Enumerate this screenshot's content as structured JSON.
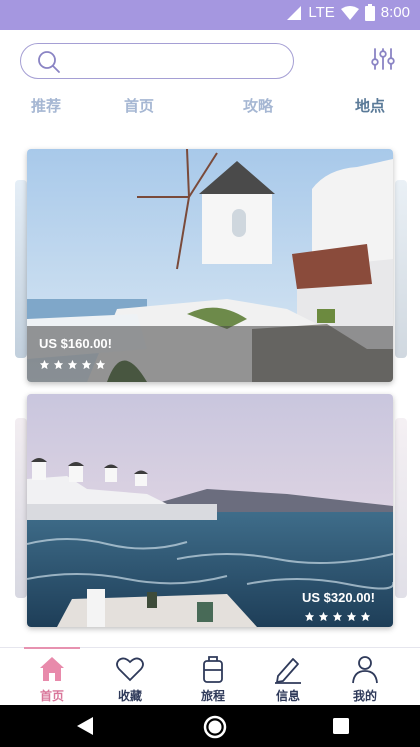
{
  "status_bar": {
    "network": "LTE",
    "time": "8:00"
  },
  "search": {
    "placeholder": "",
    "value": ""
  },
  "tabs": [
    {
      "label": "推荐",
      "active": false
    },
    {
      "label": "首页",
      "active": false
    },
    {
      "label": "攻略",
      "active": false
    },
    {
      "label": "地点",
      "active": true
    }
  ],
  "cards": [
    {
      "price": "US $160.00!",
      "rating": 5
    },
    {
      "price": "US $320.00!",
      "rating": 5
    }
  ],
  "bottom_nav": [
    {
      "label": "首页",
      "icon": "home-icon",
      "active": true
    },
    {
      "label": "收藏",
      "icon": "heart-icon",
      "active": false
    },
    {
      "label": "旅程",
      "icon": "luggage-icon",
      "active": false
    },
    {
      "label": "信息",
      "icon": "pencil-icon",
      "active": false
    },
    {
      "label": "我的",
      "icon": "person-icon",
      "active": false
    }
  ],
  "colors": {
    "accent": "#a597e0",
    "active_nav": "#d9769a",
    "tab_active": "#5a7a98",
    "tab_inactive": "#a6b7d3"
  }
}
